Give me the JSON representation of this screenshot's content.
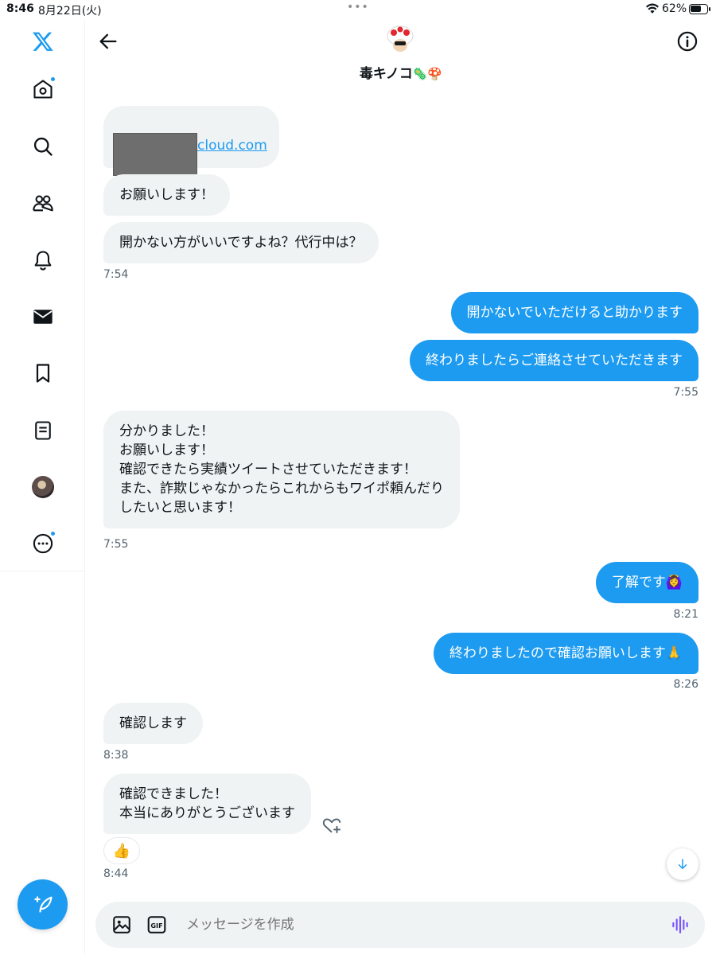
{
  "status_bar": {
    "time": "8:46",
    "date": "8月22日(火)",
    "more_dots": "•••",
    "battery_percent": "62%"
  },
  "header": {
    "name": "毒キノコ",
    "name_emoji": "🦠🍄"
  },
  "messages": {
    "m1": {
      "link": "cloud.com"
    },
    "m2": {
      "text": "お願いします！"
    },
    "m3": {
      "text": "開かない方がいいですよね？代行中は？"
    },
    "ts1": "7:54",
    "m4": {
      "text": "開かないでいただけると助かります"
    },
    "m5": {
      "text": "終わりましたらご連絡させていただきます"
    },
    "ts2": "7:55",
    "m6": {
      "text": "分かりました！\nお願いします！\n確認できたら実績ツイートさせていただきます！\nまた、詐欺じゃなかったらこれからもワイポ頼んだり\nしたいと思います！"
    },
    "ts3": "7:55",
    "m7": {
      "text": "了解です🙆‍♀️"
    },
    "ts4": "8:21",
    "m8": {
      "text": "終わりましたので確認お願いします🙏"
    },
    "ts5": "8:26",
    "m9": {
      "text": "確認します"
    },
    "ts6": "8:38",
    "m10": {
      "text": "確認できました！\n本当にありがとうございます",
      "reaction": "👍"
    },
    "ts7": "8:44"
  },
  "composer": {
    "placeholder": "メッセージを作成"
  },
  "colors": {
    "accent": "#1d9bf0",
    "received_bubble": "#eff3f4",
    "text": "#0f1419",
    "muted": "#536471"
  },
  "icons": [
    "x-logo-icon",
    "home-icon",
    "search-icon",
    "communities-icon",
    "notifications-icon",
    "messages-icon",
    "bookmarks-icon",
    "lists-icon",
    "more-icon",
    "compose-icon",
    "back-arrow-icon",
    "info-icon",
    "add-reaction-icon",
    "arrow-down-icon",
    "image-icon",
    "gif-icon",
    "voice-icon"
  ]
}
